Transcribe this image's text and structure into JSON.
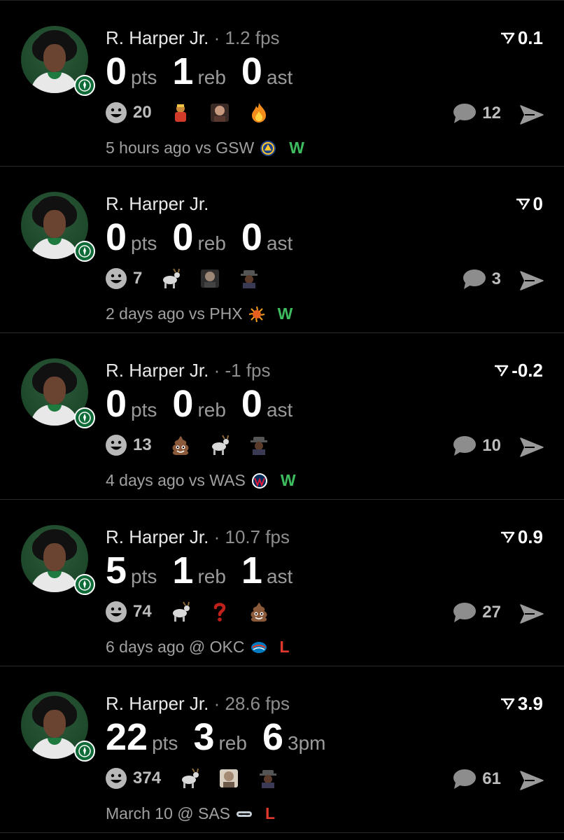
{
  "colors": {
    "win": "#3dbd5f",
    "loss": "#e0392b",
    "background": "#000000"
  },
  "posts": [
    {
      "player": "R. Harper Jr.",
      "fps": " · 1.2 fps",
      "rating": "0.1",
      "stats": [
        {
          "num": "0",
          "unit": "pts"
        },
        {
          "num": "1",
          "unit": "reb"
        },
        {
          "num": "0",
          "unit": "ast"
        }
      ],
      "reaction_count": "20",
      "emojis": [
        "wrestler-emoji",
        "meme-face-emoji",
        "fire-emoji"
      ],
      "comment_count": "12",
      "time": "5 hours ago vs GSW",
      "opponent_logo": "warriors-logo-icon",
      "result": "W"
    },
    {
      "player": "R. Harper Jr.",
      "fps": "",
      "rating": "0",
      "stats": [
        {
          "num": "0",
          "unit": "pts"
        },
        {
          "num": "0",
          "unit": "reb"
        },
        {
          "num": "0",
          "unit": "ast"
        }
      ],
      "reaction_count": "7",
      "emojis": [
        "goat-emoji",
        "meme-face-emoji",
        "snoop-emoji"
      ],
      "comment_count": "3",
      "time": "2 days ago vs PHX",
      "opponent_logo": "suns-logo-icon",
      "result": "W"
    },
    {
      "player": "R. Harper Jr.",
      "fps": " · -1 fps",
      "rating": "-0.2",
      "stats": [
        {
          "num": "0",
          "unit": "pts"
        },
        {
          "num": "0",
          "unit": "reb"
        },
        {
          "num": "0",
          "unit": "ast"
        }
      ],
      "reaction_count": "13",
      "emojis": [
        "poop-emoji",
        "goat-emoji",
        "snoop-emoji"
      ],
      "comment_count": "10",
      "time": "4 days ago vs WAS",
      "opponent_logo": "wizards-logo-icon",
      "result": "W"
    },
    {
      "player": "R. Harper Jr.",
      "fps": " · 10.7 fps",
      "rating": "0.9",
      "stats": [
        {
          "num": "5",
          "unit": "pts"
        },
        {
          "num": "1",
          "unit": "reb"
        },
        {
          "num": "1",
          "unit": "ast"
        }
      ],
      "reaction_count": "74",
      "emojis": [
        "goat-emoji",
        "question-emoji",
        "poop-emoji"
      ],
      "comment_count": "27",
      "time": "6 days ago @ OKC",
      "opponent_logo": "thunder-logo-icon",
      "result": "L"
    },
    {
      "player": "R. Harper Jr.",
      "fps": " · 28.6 fps",
      "rating": "3.9",
      "stats": [
        {
          "num": "22",
          "unit": "pts"
        },
        {
          "num": "3",
          "unit": "reb"
        },
        {
          "num": "6",
          "unit": "3pm"
        }
      ],
      "reaction_count": "374",
      "emojis": [
        "goat-emoji",
        "meme-face-emoji",
        "snoop-emoji"
      ],
      "comment_count": "61",
      "time": "March 10 @ SAS",
      "opponent_logo": "spurs-logo-icon",
      "result": "L"
    }
  ]
}
